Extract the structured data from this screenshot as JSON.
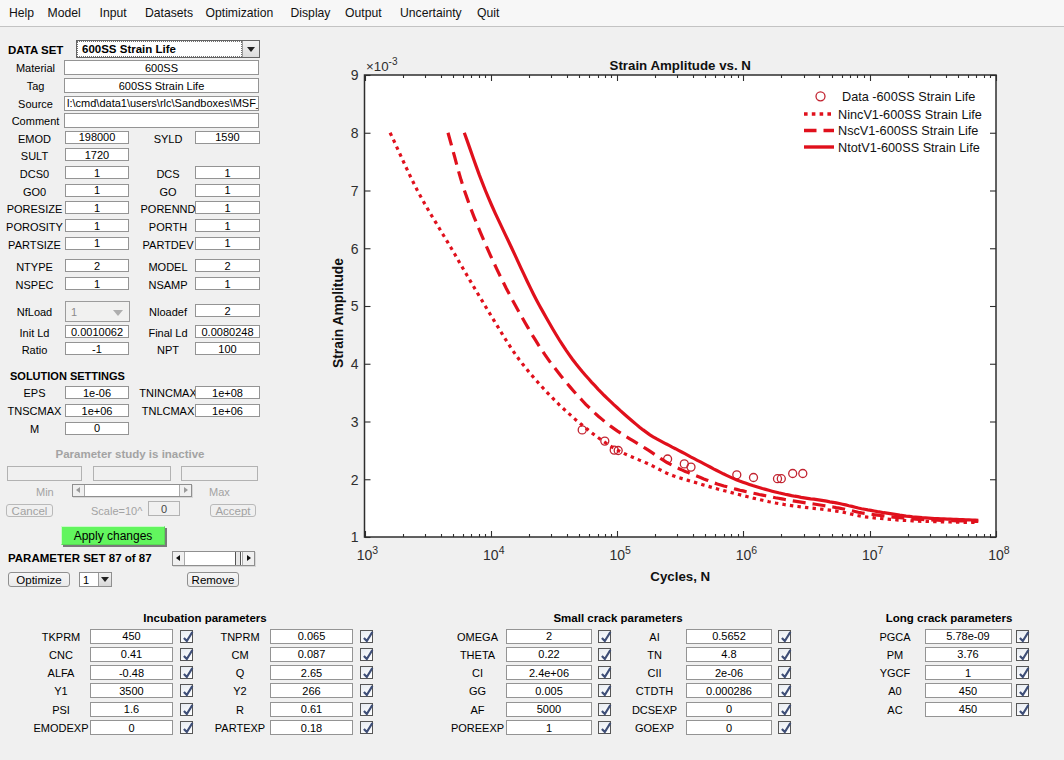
{
  "menu": {
    "items": [
      "Help",
      "Model",
      "Input",
      "Datasets",
      "Optimization",
      "Display",
      "Output",
      "Uncertainty",
      "Quit"
    ]
  },
  "dataset": {
    "label": "DATA SET",
    "value": "600SS Strain Life"
  },
  "info_fields": [
    {
      "label": "Material",
      "value": "600SS",
      "align": "center"
    },
    {
      "label": "Tag",
      "value": "600SS Strain Life",
      "align": "center"
    },
    {
      "label": "Source",
      "value": "l:\\cmd\\data1\\users\\rlc\\Sandboxes\\MSF_",
      "align": "left"
    },
    {
      "label": "Comment",
      "value": "",
      "align": "left"
    }
  ],
  "param_rows": [
    {
      "left": {
        "label": "EMOD",
        "value": "198000"
      },
      "right": {
        "label": "SYLD",
        "value": "1590"
      }
    },
    {
      "left": {
        "label": "SULT",
        "value": "1720"
      },
      "right": null
    },
    {
      "left": {
        "label": "DCS0",
        "value": "1"
      },
      "right": {
        "label": "DCS",
        "value": "1"
      }
    },
    {
      "left": {
        "label": "GO0",
        "value": "1"
      },
      "right": {
        "label": "GO",
        "value": "1"
      }
    },
    {
      "left": {
        "label": "PORESIZE",
        "value": "1"
      },
      "right": {
        "label": "PORENND",
        "value": "1"
      }
    },
    {
      "left": {
        "label": "POROSITY",
        "value": "1"
      },
      "right": {
        "label": "PORTH",
        "value": "1"
      }
    },
    {
      "left": {
        "label": "PARTSIZE",
        "value": "1"
      },
      "right": {
        "label": "PARTDEV",
        "value": "1"
      }
    },
    {
      "left": {
        "label": "NTYPE",
        "value": "2"
      },
      "right": {
        "label": "MODEL",
        "value": "2"
      }
    },
    {
      "left": {
        "label": "NSPEC",
        "value": "1"
      },
      "right": {
        "label": "NSAMP",
        "value": "1"
      }
    },
    {
      "left": {
        "label": "NfLoad",
        "value": "1",
        "widget": "combo-disabled"
      },
      "right": {
        "label": "Nloadef",
        "value": "2"
      }
    },
    {
      "left": {
        "label": "Init Ld",
        "value": "0.0010062"
      },
      "right": {
        "label": "Final Ld",
        "value": "0.0080248"
      }
    },
    {
      "left": {
        "label": "Ratio",
        "value": "-1"
      },
      "right": {
        "label": "NPT",
        "value": "100"
      }
    }
  ],
  "solution": {
    "title": "SOLUTION SETTINGS",
    "rows": [
      {
        "left": {
          "label": "EPS",
          "value": "1e-06"
        },
        "right": {
          "label": "TNINCMAX",
          "value": "1e+08"
        }
      },
      {
        "left": {
          "label": "TNSCMAX",
          "value": "1e+06"
        },
        "right": {
          "label": "TNLCMAX",
          "value": "1e+06"
        }
      },
      {
        "left": {
          "label": "M",
          "value": "0"
        },
        "right": null
      }
    ]
  },
  "param_study": {
    "status": "Parameter study is inactive",
    "min_label": "Min",
    "max_label": "Max",
    "cancel_label": "Cancel",
    "scale_label": "Scale=10^",
    "scale_value": "0",
    "accept_label": "Accept",
    "apply_label": "Apply changes"
  },
  "param_set": {
    "label": "PARAMETER SET 87 of 87",
    "optimize_label": "Optimize",
    "selector_value": "1",
    "remove_label": "Remove"
  },
  "groups": [
    {
      "title": "Incubation parameters",
      "rows": [
        [
          {
            "label": "TKPRM",
            "value": "450",
            "checked": true
          },
          {
            "label": "TNPRM",
            "value": "0.065",
            "checked": true
          }
        ],
        [
          {
            "label": "CNC",
            "value": "0.41",
            "checked": true
          },
          {
            "label": "CM",
            "value": "0.087",
            "checked": true
          }
        ],
        [
          {
            "label": "ALFA",
            "value": "-0.48",
            "checked": true
          },
          {
            "label": "Q",
            "value": "2.65",
            "checked": true
          }
        ],
        [
          {
            "label": "Y1",
            "value": "3500",
            "checked": true
          },
          {
            "label": "Y2",
            "value": "266",
            "checked": true
          }
        ],
        [
          {
            "label": "PSI",
            "value": "1.6",
            "checked": true
          },
          {
            "label": "R",
            "value": "0.61",
            "checked": true
          }
        ],
        [
          {
            "label": "EMODEXP",
            "value": "0",
            "checked": true
          },
          {
            "label": "PARTEXP",
            "value": "0.18",
            "checked": true
          }
        ]
      ]
    },
    {
      "title": "Small crack parameters",
      "rows": [
        [
          {
            "label": "OMEGA",
            "value": "2",
            "checked": true
          },
          {
            "label": "AI",
            "value": "0.5652",
            "checked": true
          }
        ],
        [
          {
            "label": "THETA",
            "value": "0.22",
            "checked": true
          },
          {
            "label": "TN",
            "value": "4.8",
            "checked": true
          }
        ],
        [
          {
            "label": "CI",
            "value": "2.4e+06",
            "checked": true
          },
          {
            "label": "CII",
            "value": "2e-06",
            "checked": true
          }
        ],
        [
          {
            "label": "GG",
            "value": "0.005",
            "checked": true
          },
          {
            "label": "CTDTH",
            "value": "0.000286",
            "checked": true
          }
        ],
        [
          {
            "label": "AF",
            "value": "5000",
            "checked": true
          },
          {
            "label": "DCSEXP",
            "value": "0",
            "checked": true
          }
        ],
        [
          {
            "label": "POREEXP",
            "value": "1",
            "checked": true
          },
          {
            "label": "GOEXP",
            "value": "0",
            "checked": true
          }
        ]
      ]
    },
    {
      "title": "Long crack parameters",
      "rows": [
        [
          {
            "label": "PGCA",
            "value": "5.78e-09",
            "checked": true
          }
        ],
        [
          {
            "label": "PM",
            "value": "3.76",
            "checked": true
          }
        ],
        [
          {
            "label": "YGCF",
            "value": "1",
            "checked": true
          }
        ],
        [
          {
            "label": "A0",
            "value": "450",
            "checked": true
          }
        ],
        [
          {
            "label": "AC",
            "value": "450",
            "checked": true
          }
        ]
      ]
    }
  ],
  "chart_data": {
    "type": "line",
    "title": "Strain Amplitude vs. N",
    "xlabel": "Cycles, N",
    "ylabel": "Strain Amplitude",
    "x_scale": "log",
    "xlim": [
      1000,
      100000000
    ],
    "ylim_milli": [
      1,
      9
    ],
    "y_exponent_label": "-3",
    "y_ticks_milli": [
      1,
      2,
      3,
      4,
      5,
      6,
      7,
      8,
      9
    ],
    "x_tick_exponents": [
      3,
      4,
      5,
      6,
      7,
      8
    ],
    "grid": false,
    "legend_position": "northeast",
    "axis_color": "#2e2e2e",
    "curve_color": "#e0101c",
    "marker_color": "#c22330",
    "series": [
      {
        "name": "Data -600SS Strain Life",
        "style": "scatter",
        "marker": "circle",
        "points_logN_mStrain": [
          [
            4.724,
            2.855
          ],
          [
            4.903,
            2.661
          ],
          [
            4.977,
            2.505
          ],
          [
            5.009,
            2.498
          ],
          [
            5.4,
            2.35
          ],
          [
            5.532,
            2.265
          ],
          [
            5.585,
            2.21
          ],
          [
            5.948,
            2.077
          ],
          [
            6.08,
            2.03
          ],
          [
            6.27,
            2.01
          ],
          [
            6.3,
            2.01
          ],
          [
            6.39,
            2.1
          ],
          [
            6.47,
            2.1
          ]
        ]
      },
      {
        "name": "NincV1-600SS Strain Life",
        "style": "dotted",
        "points_logN_mStrain": [
          [
            3.203,
            8
          ],
          [
            3.419,
            7
          ],
          [
            3.687,
            6
          ],
          [
            3.956,
            5
          ],
          [
            4.25,
            4
          ],
          [
            4.689,
            3
          ],
          [
            5.007,
            2.5
          ],
          [
            5.262,
            2.25
          ],
          [
            5.42,
            2.08
          ],
          [
            5.61,
            1.95
          ],
          [
            5.85,
            1.8
          ],
          [
            6.33,
            1.56
          ],
          [
            6.76,
            1.44
          ],
          [
            6.96,
            1.35
          ],
          [
            7.44,
            1.27
          ],
          [
            7.86,
            1.25
          ]
        ]
      },
      {
        "name": "NscV1-600SS Strain Life",
        "style": "dashed",
        "points_logN_mStrain": [
          [
            3.661,
            8
          ],
          [
            3.791,
            7
          ],
          [
            3.972,
            6
          ],
          [
            4.197,
            5
          ],
          [
            4.48,
            4
          ],
          [
            4.901,
            3
          ],
          [
            5.25,
            2.5
          ],
          [
            5.42,
            2.26
          ],
          [
            5.66,
            2.03
          ],
          [
            5.82,
            1.9
          ],
          [
            6.33,
            1.65
          ],
          [
            6.76,
            1.5
          ],
          [
            6.96,
            1.41
          ],
          [
            7.44,
            1.3
          ],
          [
            7.86,
            1.27
          ]
        ]
      },
      {
        "name": "NtotV1-600SS Strain Life",
        "style": "solid",
        "points_logN_mStrain": [
          [
            3.79,
            8
          ],
          [
            3.957,
            7
          ],
          [
            4.166,
            6
          ],
          [
            4.387,
            5
          ],
          [
            4.674,
            4
          ],
          [
            5.124,
            3
          ],
          [
            5.26,
            2.77
          ],
          [
            5.487,
            2.5
          ],
          [
            5.66,
            2.3
          ],
          [
            5.97,
            1.97
          ],
          [
            6.33,
            1.74
          ],
          [
            6.76,
            1.58
          ],
          [
            6.96,
            1.48
          ],
          [
            7.44,
            1.33
          ],
          [
            7.86,
            1.29
          ]
        ]
      }
    ]
  }
}
